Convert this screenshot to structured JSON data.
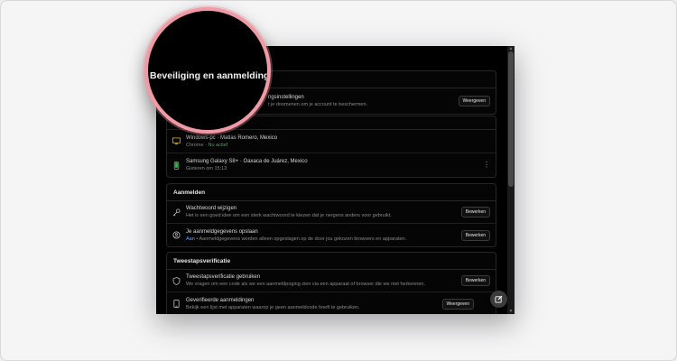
{
  "magnifier": {
    "title": "Beveiliging en aanmelding"
  },
  "security_card": {
    "row_title_partial": "ngsinstellingen",
    "row_sub_partial": "t je doomenen om je account te beschermen.",
    "button": "Weergeven"
  },
  "devices_card": {
    "devices": [
      {
        "name": "Windows-pc · Matias Romero, Mexico",
        "browser": "Chrome",
        "status": "Nu actief",
        "icon": "monitor-icon"
      },
      {
        "name": "Samsung Galaxy S8+ · Oaxaca de Juárez, Mexico",
        "status": "Gisteren om 15:13",
        "icon": "phone-icon"
      }
    ]
  },
  "login_card": {
    "header": "Aanmelden",
    "rows": [
      {
        "title": "Wachtwoord wijzigen",
        "sub": "Het is een goed idee om een sterk wachtwoord te kiezen dat je nergens anders voor gebruikt.",
        "button": "Bewerken"
      },
      {
        "title": "Je aanmeldgegevens opslaan",
        "sub_prefix": "Aan",
        "sub": " • Aanmeldgegevens worden alleen opgeslagen op de door jou gekozen browsers en apparaten.",
        "button": "Bewerken"
      }
    ]
  },
  "twofa_card": {
    "header": "Tweestapsverificatie",
    "rows": [
      {
        "title": "Tweestapsverificatie gebruiken",
        "sub": "We vragen om een code als we een aanmeldpoging zien via een apparaat of browser die we niet herkennen.",
        "button": "Bewerken"
      },
      {
        "title": "Geverifieerde aanmeldingen",
        "sub": "Bekijk een lijst met apparaten waarop je geen aanmeldcode hoeft te gebruiken.",
        "button": "Weergeven"
      }
    ]
  },
  "colors": {
    "accent_green": "#3fb950",
    "accent_blue": "#58a6ff",
    "magnifier_ring": "#f19aa5"
  }
}
